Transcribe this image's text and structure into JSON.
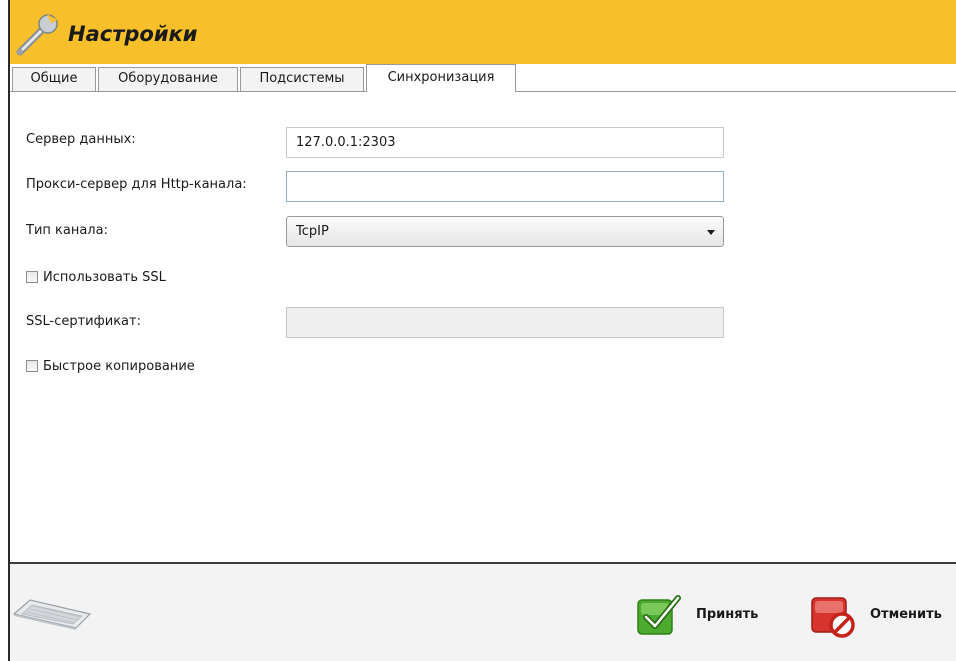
{
  "window": {
    "title": "Настройки",
    "title_icon": "wrench-icon"
  },
  "tabs": [
    {
      "label": "Общие",
      "active": false
    },
    {
      "label": "Оборудование",
      "active": false
    },
    {
      "label": "Подсистемы",
      "active": false
    },
    {
      "label": "Синхронизация",
      "active": true
    }
  ],
  "form": {
    "data_server": {
      "label": "Сервер данных:",
      "value": "127.0.0.1:2303"
    },
    "http_proxy": {
      "label": "Прокси-сервер для Http-канала:",
      "value": ""
    },
    "channel_type": {
      "label": "Тип канала:",
      "value": "TcpIP"
    },
    "use_ssl": {
      "label": "Использовать SSL",
      "checked": false
    },
    "ssl_certificate": {
      "label": "SSL-сертификат:",
      "value": ""
    },
    "fast_copy": {
      "label": "Быстрое копирование",
      "checked": false
    }
  },
  "footer": {
    "keyboard_icon": "keyboard-icon",
    "accept_label": "Принять",
    "accept_icon": "check-icon",
    "cancel_label": "Отменить",
    "cancel_icon": "cancel-icon"
  },
  "colors": {
    "titlebar": "#f7c02a",
    "accept": "#4caa2e",
    "cancel": "#d8332c"
  }
}
